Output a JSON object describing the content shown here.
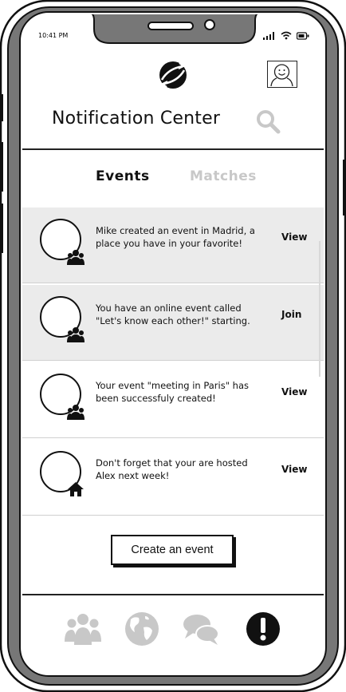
{
  "status": {
    "time": "10:41 PM"
  },
  "header": {
    "title": "Notification Center"
  },
  "tabs": [
    {
      "label": "Events",
      "active": true
    },
    {
      "label": "Matches",
      "active": false
    }
  ],
  "notifications": [
    {
      "message": "Mike created an event in Madrid, a place you have in your favorite!",
      "action": "View",
      "badge": "group-icon",
      "highlighted": true
    },
    {
      "message": "You have an online event called \"Let's know each other!\" starting.",
      "action": "Join",
      "badge": "group-icon",
      "highlighted": true
    },
    {
      "message": "Your event \"meeting in Paris\" has been successfuly created!",
      "action": "View",
      "badge": "group-icon",
      "highlighted": false
    },
    {
      "message": "Don't forget that your are hosted Alex next week!",
      "action": "View",
      "badge": "home-icon",
      "highlighted": false
    }
  ],
  "create_button": {
    "label": "Create an event"
  },
  "bottom_nav": [
    {
      "icon": "people-icon",
      "active": false
    },
    {
      "icon": "globe-icon",
      "active": false
    },
    {
      "icon": "chat-icon",
      "active": false
    },
    {
      "icon": "alert-icon",
      "active": true
    }
  ],
  "colors": {
    "inactive_gray": "#c8c8c8",
    "highlight_bg": "#ebebeb",
    "ink": "#111111"
  }
}
